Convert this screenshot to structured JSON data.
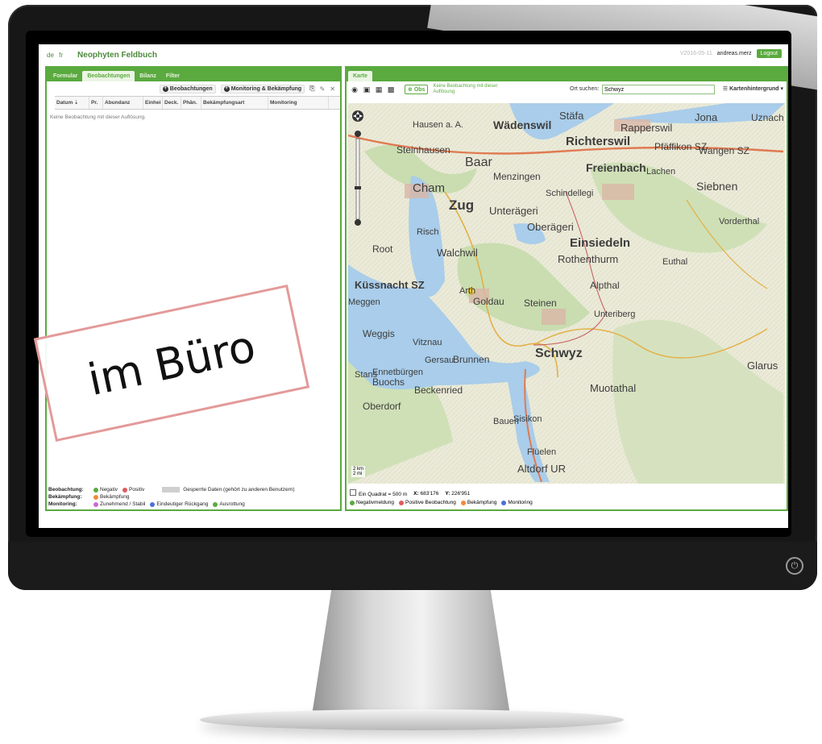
{
  "header": {
    "languages": [
      "de",
      "fr"
    ],
    "app_title": "Neophyten Feldbuch",
    "version": "V2016-05-11",
    "user": "andreas.merz",
    "logout_label": "Logout"
  },
  "left_panel": {
    "tabs": [
      {
        "label": "Formular"
      },
      {
        "label": "Beobachtungen",
        "active": true
      },
      {
        "label": "Bilanz"
      },
      {
        "label": "Filter"
      }
    ],
    "toolbar": {
      "add_observations_label": "Beobachtungen",
      "add_monitoring_label": "Monitoring & Bekämpfung"
    },
    "columns": [
      "Datum ⇣",
      "Pr.",
      "Abundanz",
      "Einhei",
      "Deck.",
      "Phän.",
      "Bekämpfungsart",
      "Monitoring"
    ],
    "empty_message": "Keine Beobachtung mit dieser Auflösung.",
    "legend": {
      "beobachtung_label": "Beobachtung:",
      "negativ": "Negativ",
      "positiv": "Positiv",
      "gesperrt": "Gesperrte Daten (gehört zu anderen Benutzern)",
      "bekaempfung_label": "Bekämpfung:",
      "bekaempfung": "Bekämpfung",
      "monitoring_label": "Monitoring:",
      "zunehmend": "Zunehmend / Stabil",
      "rueckgang": "Eindeutiger Rückgang",
      "ausrottung": "Ausrottung"
    },
    "colors": {
      "negativ": "#5aaa3f",
      "positiv": "#e05a5a",
      "bekaempfung": "#f08a3c",
      "zunehmend": "#c86bd2",
      "rueckgang": "#4d6fd6",
      "ausrottung": "#5aaa3f"
    }
  },
  "right_panel": {
    "tab_label": "Karte",
    "obs_button": "Obs",
    "no_observation_text": "Keine Beobachtung mit dieser Auflösung",
    "search_label": "Ort suchen:",
    "search_value": "Schwyz",
    "background_button": "Kartenhintergrund",
    "quadrat_label": "Ein Quadrat = 500 m",
    "x_label": "X:",
    "x_value": "683'176",
    "y_label": "Y:",
    "y_value": "226'951",
    "scale_km": "2 km",
    "scale_mi": "2 mi",
    "map_legend": {
      "negativ": "Negativmeldung",
      "positiv": "Positive Beobachtung",
      "bekaempfung": "Bekämpfung",
      "monitoring": "Monitoring"
    },
    "map_colors": {
      "negativ": "#5aaa3f",
      "positiv": "#e05a5a",
      "bekaempfung": "#f08a3c",
      "monitoring": "#4d6fd6"
    },
    "place_names": [
      "Stäfa",
      "Jona",
      "Uznach",
      "Hausen a. A.",
      "Wädenswil",
      "Rapperswil",
      "Richterswil",
      "Pfäffikon SZ",
      "Wangen SZ",
      "Steinhausen",
      "Baar",
      "Menzingen",
      "Freienbach",
      "Lachen",
      "Cham",
      "Zug",
      "Schindellegi",
      "Siebnen",
      "Risch",
      "Unterägeri",
      "Oberägeri",
      "Einsiedeln",
      "Vorderthal",
      "Root",
      "Walchwil",
      "Rothenthurm",
      "Euthal",
      "Küssnacht SZ",
      "Arth",
      "Goldau",
      "Steinen",
      "Alpthal",
      "Meggen",
      "Unteriberg",
      "Weggis",
      "Vitznau",
      "Gersau",
      "Brunnen",
      "Schwyz",
      "Muotathal",
      "Ennetbürgen",
      "Buochs",
      "Beckenried",
      "Stans",
      "Oberdorf",
      "Bauen",
      "Sisikon",
      "Flüelen",
      "Altdorf UR",
      "Glarus"
    ]
  },
  "stamp_text": "im Büro"
}
